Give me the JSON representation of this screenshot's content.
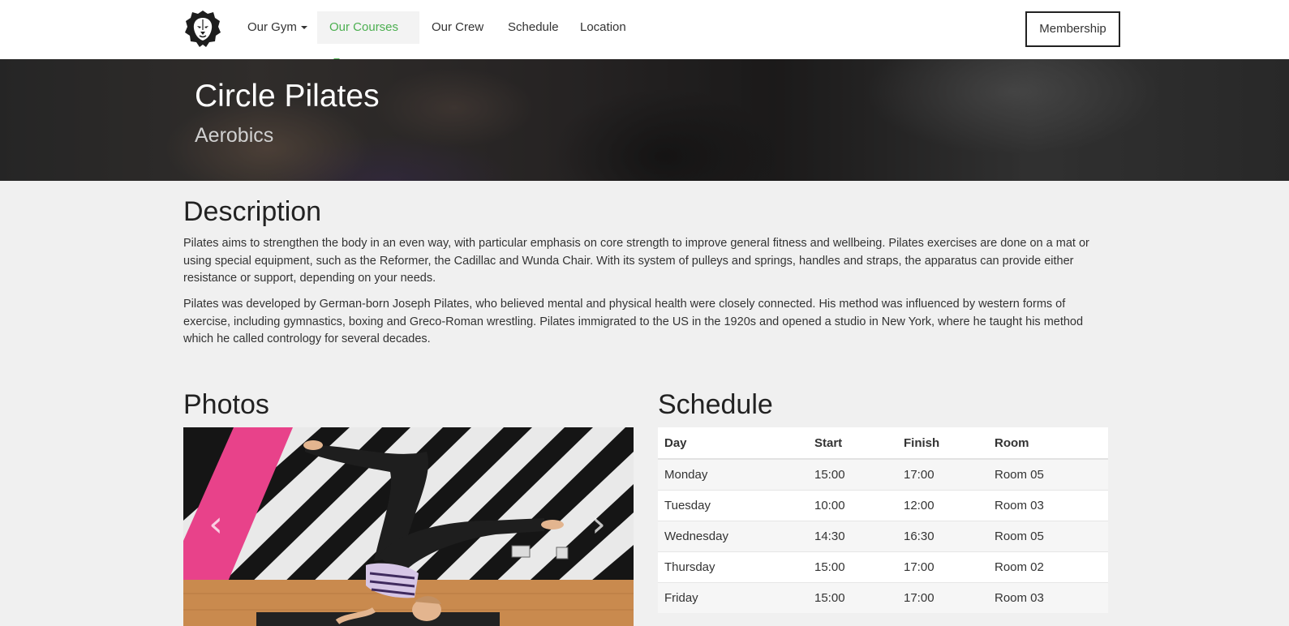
{
  "nav": {
    "logo_icon": "lion-head-icon",
    "items": [
      {
        "label": "Our Gym",
        "dropdown": true,
        "active": false
      },
      {
        "label": "Our Courses",
        "dropdown": true,
        "active": true
      },
      {
        "label": "Our Crew",
        "dropdown": false,
        "active": false
      },
      {
        "label": "Schedule",
        "dropdown": false,
        "active": false
      },
      {
        "label": "Location",
        "dropdown": false,
        "active": false
      }
    ],
    "membership_label": "Membership",
    "accent_color": "#4caf50"
  },
  "hero": {
    "title": "Circle Pilates",
    "subtitle": "Aerobics"
  },
  "description": {
    "heading": "Description",
    "paragraphs": [
      "Pilates aims to strengthen the body in an even way, with particular emphasis on core strength to improve general fitness and wellbeing. Pilates exercises are done on a mat or using special equipment, such as the Reformer, the Cadillac and Wunda Chair. With its system of pulleys and springs, handles and straps, the apparatus can provide either resistance or support, depending on your needs.",
      "Pilates was developed by German-born Joseph Pilates, who believed mental and physical health were closely connected. His method was influenced by western forms of exercise, including gymnastics, boxing and Greco-Roman wrestling. Pilates immigrated to the US in the 1920s and opened a studio in New York, where he taught his method which he called contrology  for several decades."
    ]
  },
  "photos": {
    "heading": "Photos",
    "prev_icon": "chevron-left-icon",
    "next_icon": "chevron-right-icon",
    "prev_glyph": "‹",
    "next_glyph": "›"
  },
  "schedule": {
    "heading": "Schedule",
    "columns": [
      "Day",
      "Start",
      "Finish",
      "Room"
    ],
    "rows": [
      [
        "Monday",
        "15:00",
        "17:00",
        "Room 05"
      ],
      [
        "Tuesday",
        "10:00",
        "12:00",
        "Room 03"
      ],
      [
        "Wednesday",
        "14:30",
        "16:30",
        "Room 05"
      ],
      [
        "Thursday",
        "15:00",
        "17:00",
        "Room 02"
      ],
      [
        "Friday",
        "15:00",
        "17:00",
        "Room 03"
      ]
    ]
  }
}
